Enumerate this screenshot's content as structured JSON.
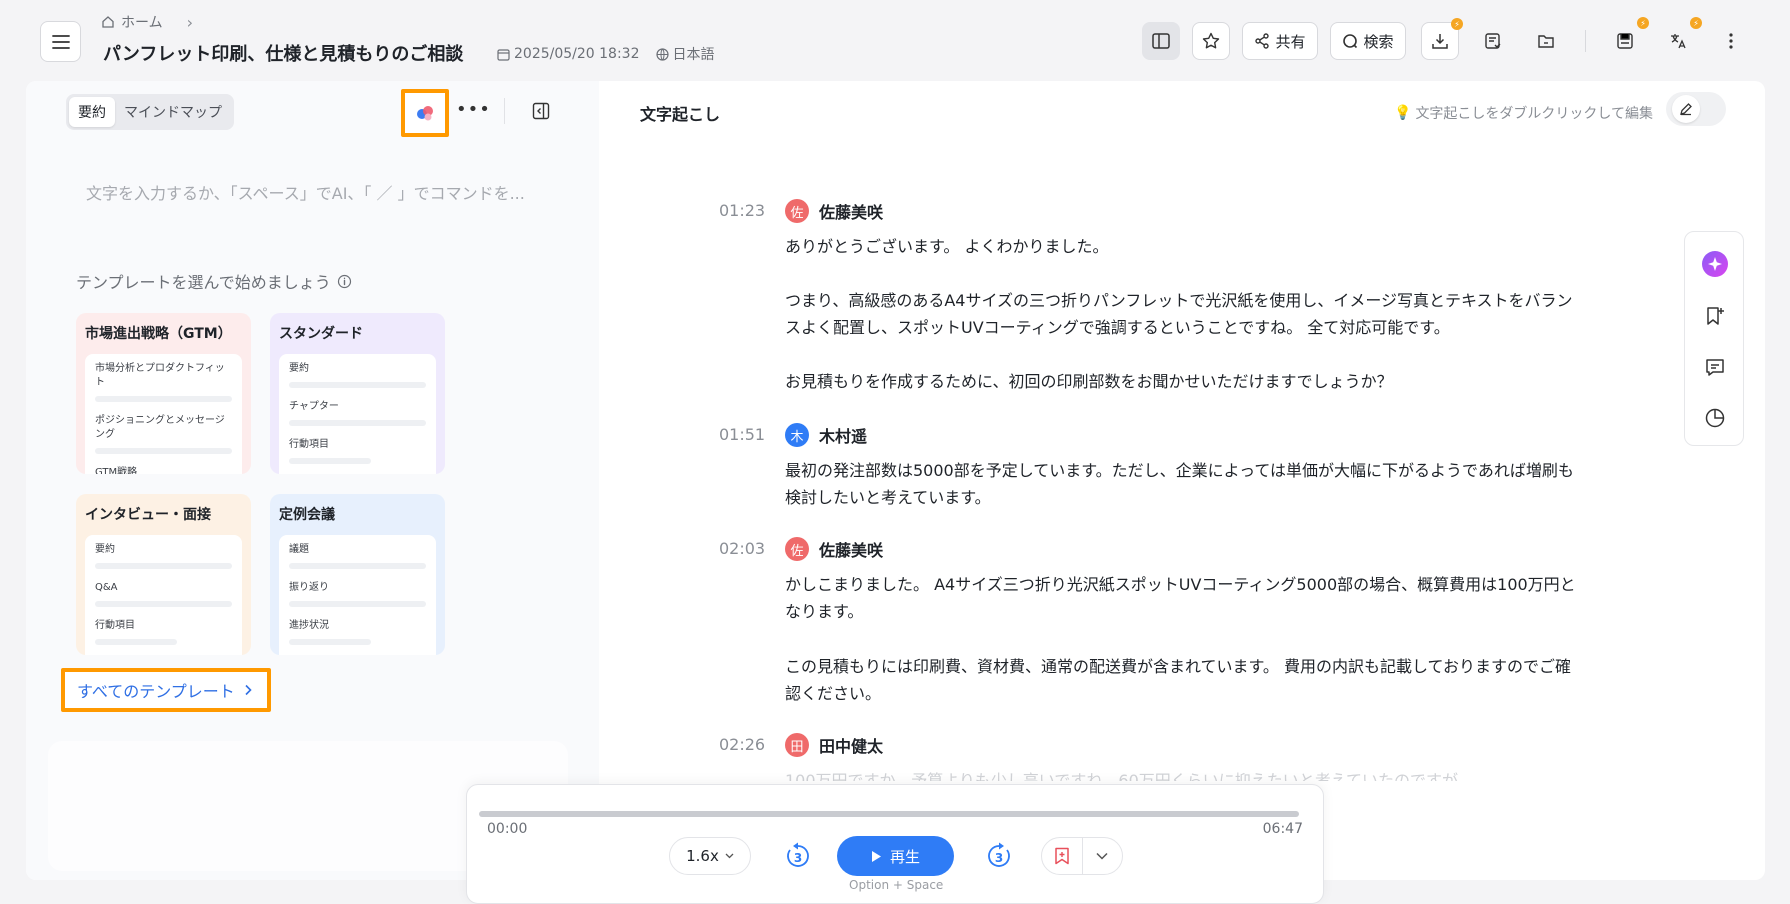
{
  "header": {
    "breadcrumb_home": "ホーム",
    "title": "パンフレット印刷、仕様と見積もりのご相談",
    "date": "2025/05/20 18:32",
    "language": "日本語",
    "share_label": "共有",
    "search_label": "検索"
  },
  "left_panel": {
    "tabs": [
      "要約",
      "マインドマップ"
    ],
    "editor_placeholder": "文字を入力するか、「スペース」でAI、「 ／ 」でコマンドを...",
    "template_prompt": "テンプレートを選んで始めましょう",
    "templates": [
      {
        "title": "市場進出戦略（GTM）",
        "items": [
          "市場分析とプロダクトフィット",
          "ポジショニングとメッセージング",
          "GTM戦略"
        ]
      },
      {
        "title": "スタンダード",
        "items": [
          "要約",
          "チャプター",
          "行動項目"
        ]
      },
      {
        "title": "インタビュー・面接",
        "items": [
          "要約",
          "Q&A",
          "行動項目"
        ]
      },
      {
        "title": "定例会議",
        "items": [
          "議題",
          "振り返り",
          "進捗状況"
        ]
      }
    ],
    "all_templates_label": "すべてのテンプレート"
  },
  "transcript": {
    "title": "文字起こし",
    "hint": "文字起こしをダブルクリックして編集",
    "entries": [
      {
        "time": "01:23",
        "speaker": "佐藤美咲",
        "initial": "佐",
        "color": "#ef6a6a",
        "paragraphs": [
          "ありがとうございます。 よくわかりました。",
          "つまり、高級感のあるA4サイズの三つ折りパンフレットで光沢紙を使用し、イメージ写真とテキストをバランスよく配置し、スポットUVコーティングで強調するということですね。 全て対応可能です。",
          "お見積もりを作成するために、初回の印刷部数をお聞かせいただけますでしょうか？"
        ]
      },
      {
        "time": "01:51",
        "speaker": "木村遥",
        "initial": "木",
        "color": "#2f7cf6",
        "paragraphs": [
          "最初の発注部数は5000部を予定しています。ただし、企業によっては単価が大幅に下がるようであれば増刷も検討したいと考えています。"
        ]
      },
      {
        "time": "02:03",
        "speaker": "佐藤美咲",
        "initial": "佐",
        "color": "#ef6a6a",
        "paragraphs": [
          "かしこまりました。 A4サイズ三つ折り光沢紙スポットUVコーティング5000部の場合、概算費用は100万円となります。",
          "この見積もりには印刷費、資材費、通常の配送費が含まれています。 費用の内訳も記載しておりますのでご確認ください。"
        ]
      },
      {
        "time": "02:26",
        "speaker": "田中健太",
        "initial": "田",
        "color": "#ef6a6a",
        "paragraphs": [
          "100万円ですか。予算よりも少し高いですね。60万円くらいに抑えたいと考えていたのですが"
        ]
      }
    ]
  },
  "player": {
    "current": "00:00",
    "duration": "06:47",
    "progress": 0,
    "speed": "1.6x",
    "skip_seconds": "3",
    "play_label": "再生",
    "shortcut": "Option + Space"
  },
  "colors": {
    "accent": "#2f7cf6",
    "highlight": "#ff9900",
    "badge": "#f5a623"
  }
}
